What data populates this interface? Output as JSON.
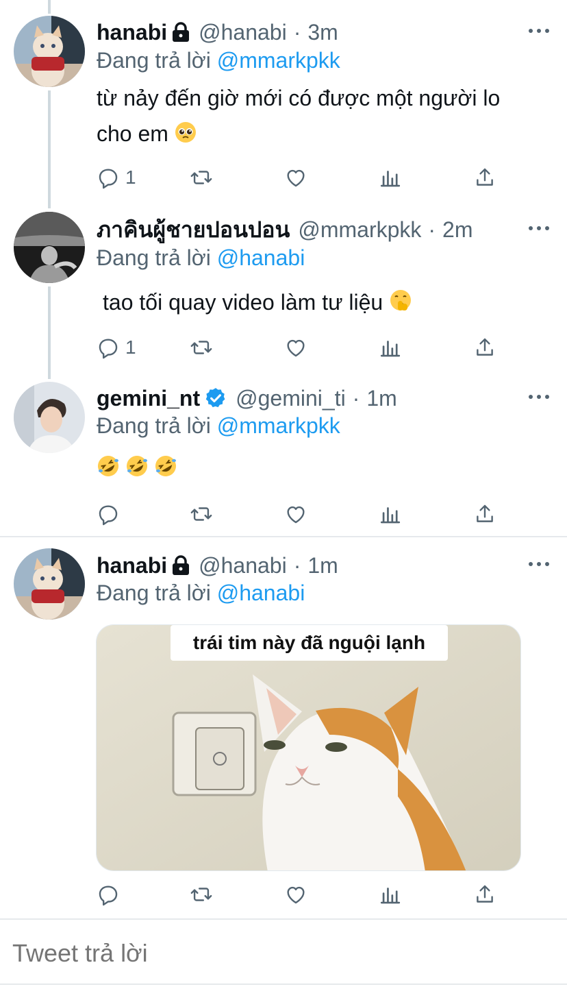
{
  "tweets": [
    {
      "name": "hanabi",
      "handle": "@hanabi",
      "sep": "·",
      "time": "3m",
      "replying_label": "Đang trả lời",
      "replying_to": "@mmarkpkk",
      "text_line1": "từ nảy đến giờ mới có được một người lo",
      "text_line2": "cho em",
      "reply_count": "1",
      "badge": "lock-icon"
    },
    {
      "name": "ภาคินผู้ชายปอนปอน",
      "handle": "@mmarkpkk",
      "sep": "·",
      "time": "2m",
      "replying_label": "Đang trả lời",
      "replying_to": "@hanabi",
      "text_line1": "tao tối quay video làm tư liệu",
      "reply_count": "1"
    },
    {
      "name": "gemini_nt",
      "handle": "@gemini_ti",
      "sep": "·",
      "time": "1m",
      "replying_label": "Đang trả lời",
      "replying_to": "@mmarkpkk",
      "badge": "verified-icon"
    },
    {
      "name": "hanabi",
      "handle": "@hanabi",
      "sep": "·",
      "time": "1m",
      "replying_label": "Đang trả lời",
      "replying_to": "@hanabi",
      "media_caption": "trái tim này đã nguội lạnh",
      "badge": "lock-icon"
    }
  ],
  "reply_box": {
    "placeholder": "Tweet trả lời"
  },
  "colors": {
    "accent": "#1d9bf0",
    "muted": "#536471",
    "verified": "#1d9bf0"
  }
}
